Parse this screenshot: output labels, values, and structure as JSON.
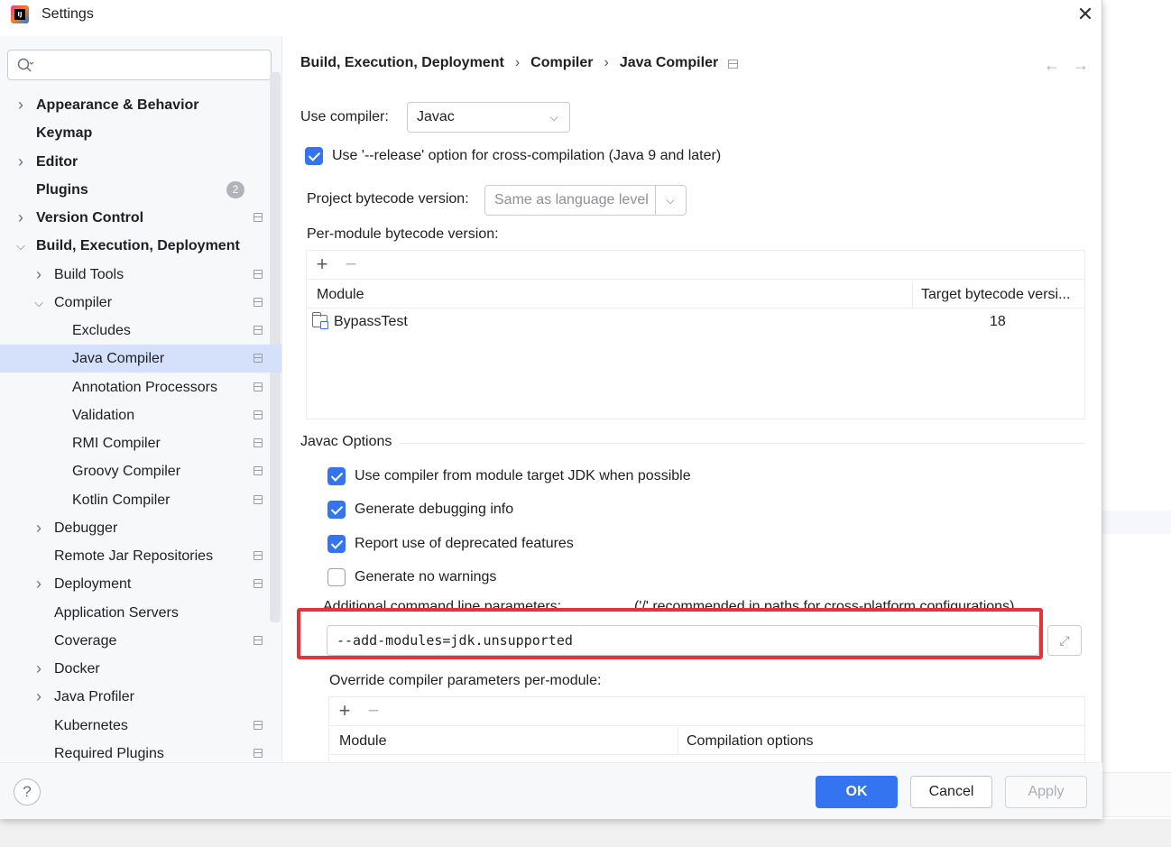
{
  "window": {
    "title": "Settings",
    "app_icon": "intellij-idea-icon",
    "close_icon": "close-icon"
  },
  "sidebar": {
    "search_placeholder": "",
    "items": [
      {
        "label": "Appearance & Behavior",
        "bold": true,
        "chevron": "right",
        "level": 0
      },
      {
        "label": "Keymap",
        "bold": true,
        "chevron": "",
        "level": 0
      },
      {
        "label": "Editor",
        "bold": true,
        "chevron": "right",
        "level": 0
      },
      {
        "label": "Plugins",
        "bold": true,
        "chevron": "",
        "level": 0,
        "badge": "2"
      },
      {
        "label": "Version Control",
        "bold": true,
        "chevron": "right",
        "level": 0,
        "project": true
      },
      {
        "label": "Build, Execution, Deployment",
        "bold": true,
        "chevron": "down",
        "level": 0
      },
      {
        "label": "Build Tools",
        "bold": false,
        "chevron": "right",
        "level": 1,
        "project": true
      },
      {
        "label": "Compiler",
        "bold": false,
        "chevron": "down",
        "level": 1,
        "project": true
      },
      {
        "label": "Excludes",
        "bold": false,
        "chevron": "",
        "level": 2,
        "project": true
      },
      {
        "label": "Java Compiler",
        "bold": false,
        "chevron": "",
        "level": 2,
        "project": true,
        "selected": true
      },
      {
        "label": "Annotation Processors",
        "bold": false,
        "chevron": "",
        "level": 2,
        "project": true
      },
      {
        "label": "Validation",
        "bold": false,
        "chevron": "",
        "level": 2,
        "project": true
      },
      {
        "label": "RMI Compiler",
        "bold": false,
        "chevron": "",
        "level": 2,
        "project": true
      },
      {
        "label": "Groovy Compiler",
        "bold": false,
        "chevron": "",
        "level": 2,
        "project": true
      },
      {
        "label": "Kotlin Compiler",
        "bold": false,
        "chevron": "",
        "level": 2,
        "project": true
      },
      {
        "label": "Debugger",
        "bold": false,
        "chevron": "right",
        "level": 1
      },
      {
        "label": "Remote Jar Repositories",
        "bold": false,
        "chevron": "",
        "level": 1,
        "project": true
      },
      {
        "label": "Deployment",
        "bold": false,
        "chevron": "right",
        "level": 1,
        "project": true
      },
      {
        "label": "Application Servers",
        "bold": false,
        "chevron": "",
        "level": 1
      },
      {
        "label": "Coverage",
        "bold": false,
        "chevron": "",
        "level": 1,
        "project": true
      },
      {
        "label": "Docker",
        "bold": false,
        "chevron": "right",
        "level": 1
      },
      {
        "label": "Java Profiler",
        "bold": false,
        "chevron": "right",
        "level": 1
      },
      {
        "label": "Kubernetes",
        "bold": false,
        "chevron": "",
        "level": 1,
        "project": true
      },
      {
        "label": "Required Plugins",
        "bold": false,
        "chevron": "",
        "level": 1,
        "project": true
      }
    ]
  },
  "breadcrumb": {
    "parts": [
      "Build, Execution, Deployment",
      "Compiler",
      "Java Compiler"
    ],
    "sep": "›"
  },
  "nav": {
    "back": "←",
    "forward": "→"
  },
  "main": {
    "use_compiler_label": "Use compiler:",
    "use_compiler_value": "Javac",
    "release_option_label": "Use '--release' option for cross-compilation (Java 9 and later)",
    "release_option_checked": true,
    "project_bytecode_label": "Project bytecode version:",
    "project_bytecode_value": "Same as language level",
    "per_module_label": "Per-module bytecode version:",
    "per_module_table": {
      "columns": [
        "Module",
        "Target bytecode versi..."
      ],
      "rows": [
        {
          "module": "BypassTest",
          "target": "18"
        }
      ]
    },
    "javac_options_title": "Javac Options",
    "options": [
      {
        "label": "Use compiler from module target JDK when possible",
        "checked": true
      },
      {
        "label": "Generate debugging info",
        "checked": true
      },
      {
        "label": "Report use of deprecated features",
        "checked": true
      },
      {
        "label": "Generate no warnings",
        "checked": false
      }
    ],
    "additional_params_label": "Additional command line parameters:",
    "additional_params_hint": "('/' recommended in paths for cross-platform configurations)",
    "additional_params_value": "--add-modules=jdk.unsupported",
    "highlight_color": "#e5333a",
    "override_label": "Override compiler parameters per-module:",
    "override_table": {
      "columns": [
        "Module",
        "Compilation options"
      ]
    }
  },
  "footer": {
    "help": "?",
    "ok": "OK",
    "cancel": "Cancel",
    "apply": "Apply"
  },
  "colors": {
    "accent": "#3574f0",
    "selected_row": "#d5e1fb"
  }
}
